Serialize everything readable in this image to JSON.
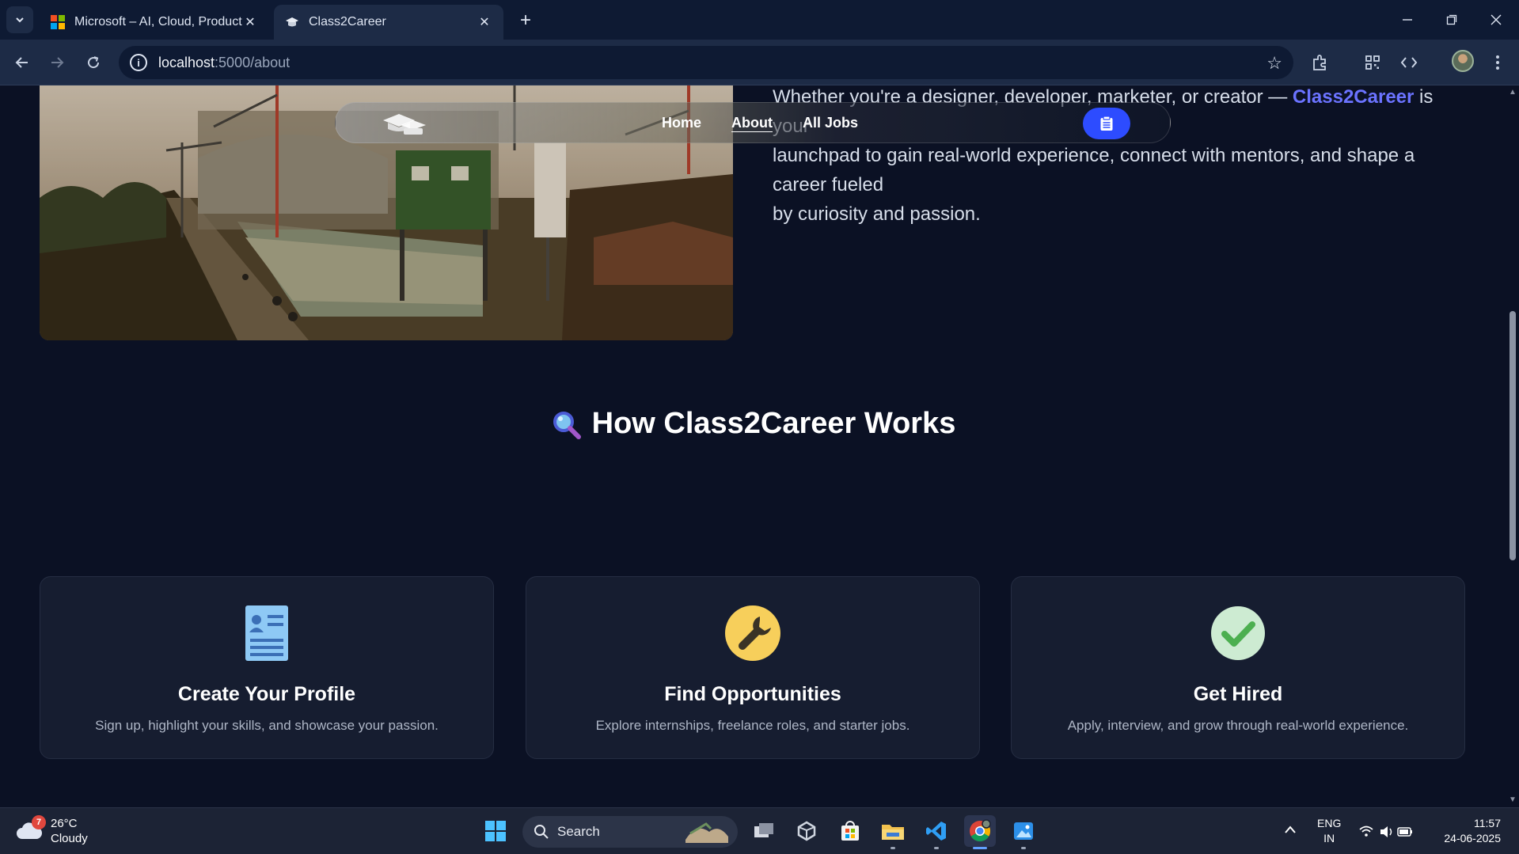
{
  "browser": {
    "tabs": [
      {
        "title": "Microsoft – AI, Cloud, Productiv",
        "active": false
      },
      {
        "title": "Class2Career",
        "active": true
      }
    ],
    "url_host": "localhost",
    "url_path": ":5000/about"
  },
  "page": {
    "about_text": {
      "line1_pre": "Whether you're a designer, developer, marketer, or creator — ",
      "brand": "Class2Career",
      "line1_post": " is your",
      "line2": "launchpad to gain real-world experience, connect with mentors, and shape a career fueled",
      "line3": "by curiosity and passion."
    },
    "nav": {
      "links": [
        "Home",
        "About",
        "All Jobs"
      ],
      "active": "About"
    },
    "section": {
      "title": "How Class2Career Works",
      "cards": [
        {
          "title": "Create Your Profile",
          "desc": "Sign up, highlight your skills, and showcase your passion.",
          "icon": "profile-card-icon"
        },
        {
          "title": "Find Opportunities",
          "desc": "Explore internships, freelance roles, and starter jobs.",
          "icon": "wrench-icon"
        },
        {
          "title": "Get Hired",
          "desc": "Apply, interview, and grow through real-world experience.",
          "icon": "check-mark-icon"
        }
      ]
    }
  },
  "taskbar": {
    "weather_temp": "26°C",
    "weather_cond": "Cloudy",
    "weather_badge": "7",
    "search_label": "Search",
    "lang_top": "ENG",
    "lang_bottom": "IN",
    "time": "11:57",
    "date": "24-06-2025"
  },
  "colors": {
    "page_bg": "#0b1124",
    "brand": "#6b73ff",
    "nav_button": "#2d4cff",
    "card_bg": "#161d30"
  }
}
